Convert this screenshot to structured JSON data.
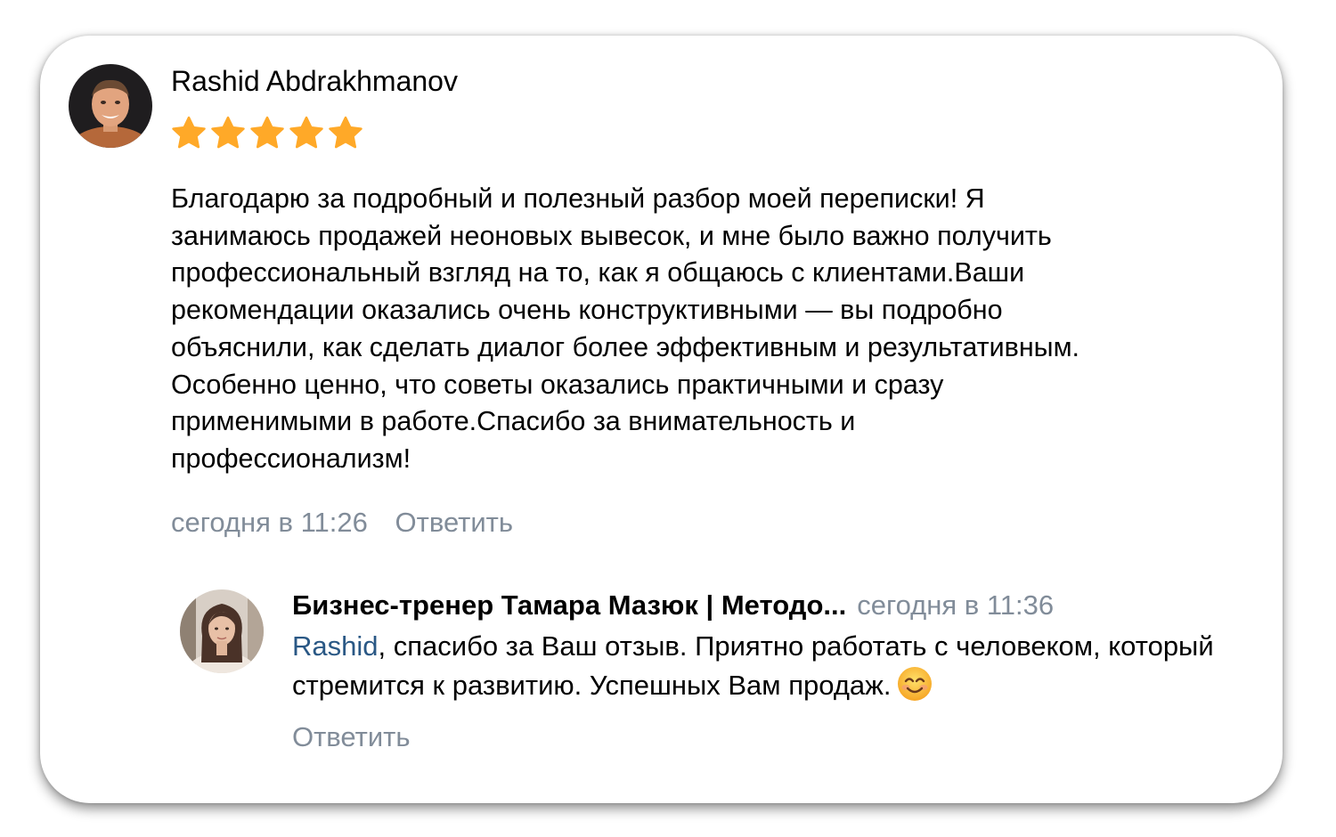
{
  "review": {
    "author": "Rashid Abdrakhmanov",
    "avatar_icon": "user-photo-avatar",
    "rating": 5,
    "rating_max": 5,
    "star_icon": "star-icon",
    "star_color": "#ffa928",
    "text": "Благодарю за подробный и полезный разбор моей переписки! Я\nзанимаюсь продажей неоновых вывесок, и мне было важно получить\nпрофессиональный взгляд на то, как я общаюсь с клиентами.Ваши\nрекомендации оказались очень конструктивными — вы подробно\nобъяснили, как сделать диалог более эффективным и результативным.\nОсобенно ценно, что советы оказались практичными и сразу\nприменимыми в работе.Спасибо за внимательность и\nпрофессионализм!",
    "timestamp": "сегодня в 11:26",
    "reply_label": "Ответить"
  },
  "reply": {
    "author": "Бизнес-тренер Тамара Мазюк | Методо...",
    "avatar_icon": "user-photo-avatar",
    "timestamp": "сегодня в 11:36",
    "mention": "Rashid",
    "text": ", спасибо за Ваш отзыв. Приятно работать с человеком, который стремится к развитию. Успешных Вам продаж.",
    "emoji_icon": "smiling-face-emoji",
    "reply_label": "Ответить"
  },
  "colors": {
    "meta_text": "#818c99",
    "mention_link": "#2a5885"
  }
}
